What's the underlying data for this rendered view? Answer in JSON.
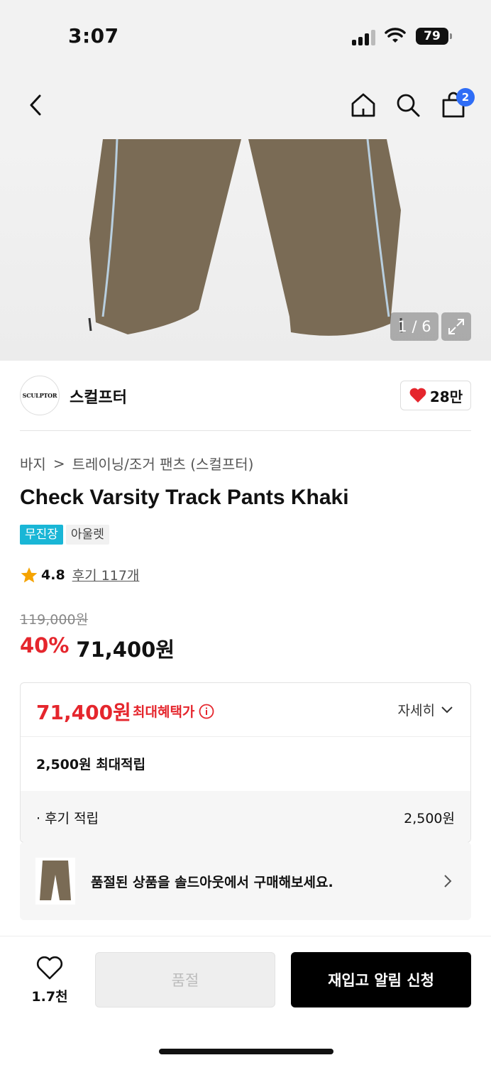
{
  "status_bar": {
    "time": "3:07",
    "battery": "79"
  },
  "nav": {
    "cart_count": "2"
  },
  "gallery": {
    "counter": "1 / 6"
  },
  "brand": {
    "logo_text": "SCULPTOR",
    "name": "스컬프터",
    "likes": "28만"
  },
  "breadcrumb": {
    "category": "바지",
    "separator": ">",
    "subcategory": "트레이닝/조거 팬츠 (스컬프터)"
  },
  "product": {
    "title": "Check Varsity Track Pants Khaki",
    "tags": [
      "무진장",
      "아울렛"
    ],
    "rating": "4.8",
    "reviews_label": "후기 117개",
    "original_price": "119,000원",
    "discount": "40%",
    "price": "71,400원"
  },
  "benefit": {
    "max_price": "71,400원",
    "max_label": "최대혜택가",
    "detail_label": "자세히",
    "points": "2,500원 최대적립",
    "review_points_label": "· 후기 적립",
    "review_points_value": "2,500원"
  },
  "soldout_banner": {
    "text": "품절된 상품을 솔드아웃에서 구매해보세요."
  },
  "bottom": {
    "wish_count": "1.7천",
    "soldout_label": "품절",
    "restock_label": "재입고 알림 신청"
  },
  "colors": {
    "accent_red": "#e5262d",
    "badge_blue": "#2f6df6",
    "tag_cyan": "#19b6d6"
  }
}
